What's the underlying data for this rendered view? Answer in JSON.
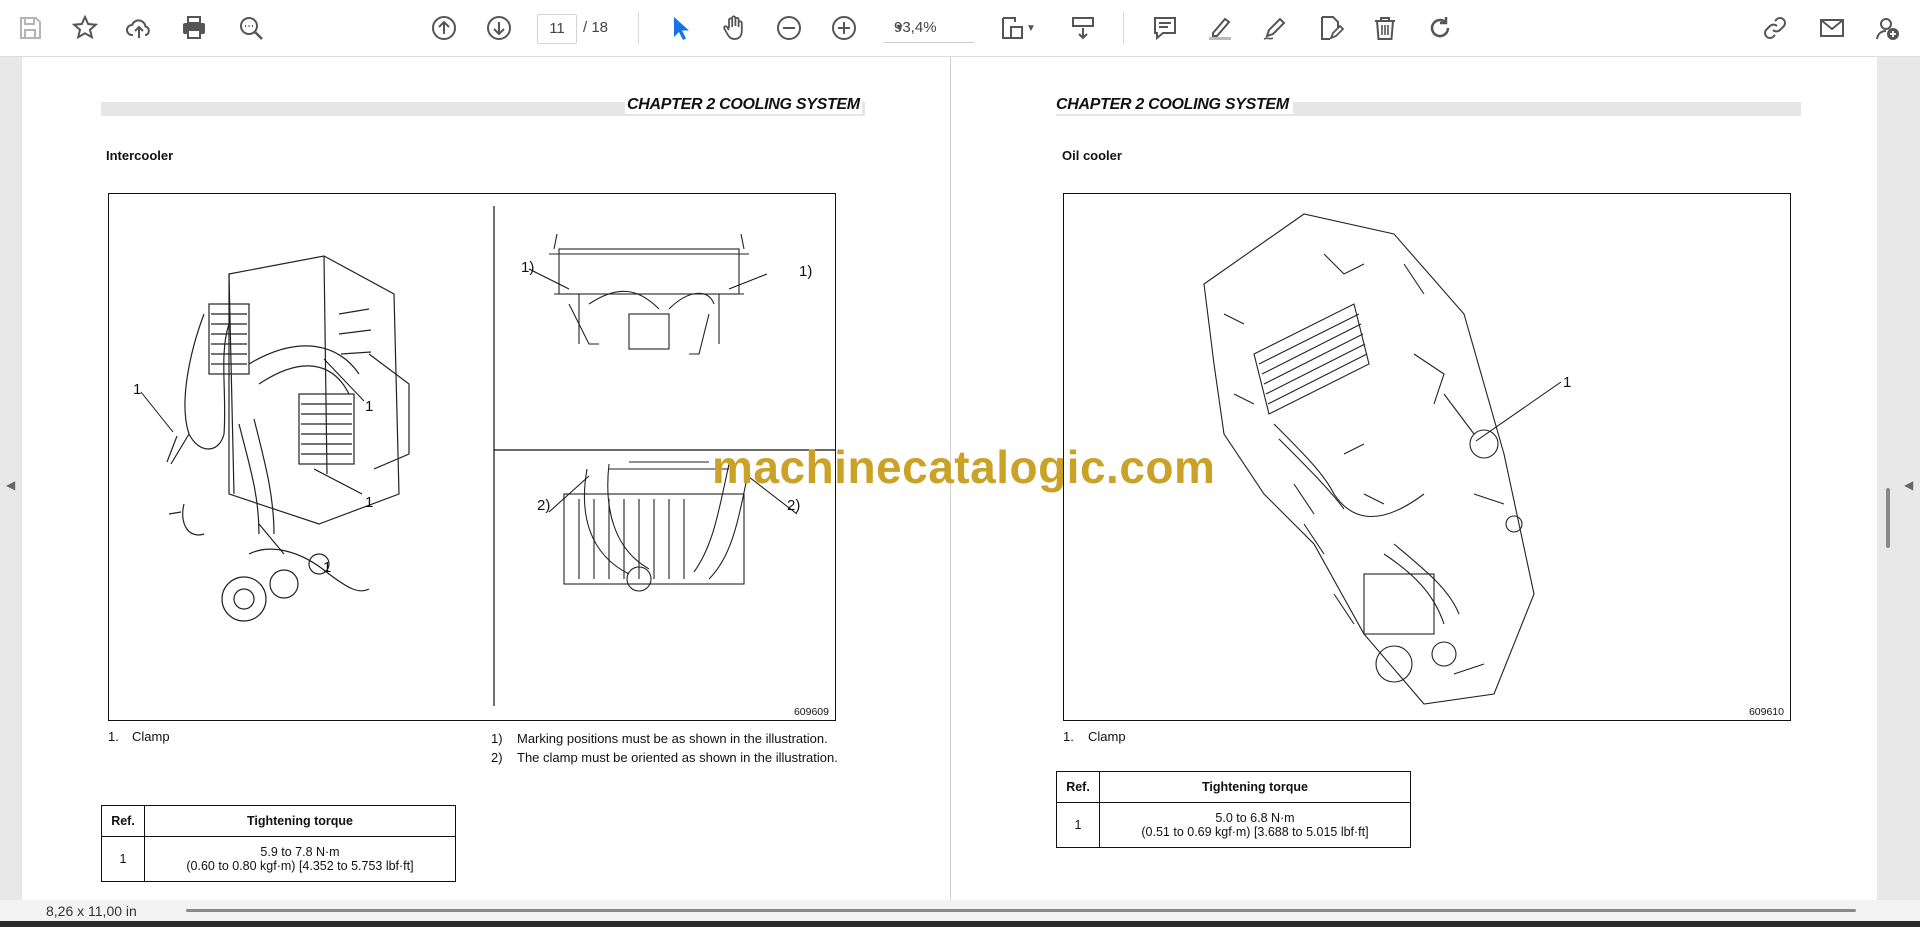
{
  "toolbar": {
    "page_current": "11",
    "page_total": "/  18",
    "zoom": "93,4%",
    "icons": [
      "save-icon",
      "star-icon",
      "cloud-upload-icon",
      "print-icon",
      "zoom-search-icon",
      "page-up-icon",
      "page-down-icon",
      "select-arrow-icon",
      "hand-icon",
      "zoom-out-icon",
      "zoom-in-icon",
      "fit-page-icon",
      "scroll-mode-icon",
      "comment-icon",
      "highlight-icon",
      "draw-icon",
      "edit-icon",
      "delete-icon",
      "rotate-icon",
      "share-link-icon",
      "email-icon",
      "add-user-icon"
    ]
  },
  "left_page": {
    "chapter": "CHAPTER 2 COOLING SYSTEM",
    "section": "Intercooler",
    "figure_number": "609609",
    "callouts_main": [
      "1",
      "1",
      "1",
      "1"
    ],
    "callouts_top": [
      "1)",
      "1)"
    ],
    "callouts_bottom": [
      "2)",
      "2)"
    ],
    "legend_num": "1.",
    "legend_text": "Clamp",
    "notes": [
      {
        "num": "1)",
        "text": "Marking positions must be as shown in the illustration."
      },
      {
        "num": "2)",
        "text": "The clamp must be oriented as shown in the illustration."
      }
    ],
    "table": {
      "headers": [
        "Ref.",
        "Tightening torque"
      ],
      "ref": "1",
      "line1": "5.9 to 7.8 N·m",
      "line2": "(0.60 to 0.80 kgf·m) [4.352 to 5.753 lbf·ft]"
    }
  },
  "right_page": {
    "chapter": "CHAPTER 2 COOLING SYSTEM",
    "section": "Oil cooler",
    "figure_number": "609610",
    "callout": "1",
    "legend_num": "1.",
    "legend_text": "Clamp",
    "table": {
      "headers": [
        "Ref.",
        "Tightening torque"
      ],
      "ref": "1",
      "line1": "5.0 to 6.8 N·m",
      "line2": "(0.51 to 0.69 kgf·m) [3.688 to 5.015 lbf·ft]"
    }
  },
  "watermark": "machinecatalogic.com",
  "status": {
    "page_size": "8,26 x 11,00 in"
  },
  "colors": {
    "accent_blue": "#1473e6",
    "watermark": "#c9a227"
  }
}
